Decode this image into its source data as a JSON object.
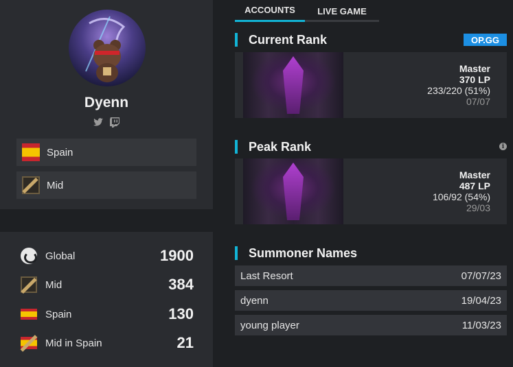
{
  "profile": {
    "name": "Dyenn",
    "socials": [
      {
        "icon": "twitter-icon"
      },
      {
        "icon": "twitch-icon"
      }
    ],
    "country": "Spain",
    "role": "Mid"
  },
  "rankings": [
    {
      "icon": "globe-icon",
      "label": "Global",
      "value": "1900"
    },
    {
      "icon": "mid-lane-icon",
      "label": "Mid",
      "value": "384"
    },
    {
      "icon": "spain-flag-icon",
      "label": "Spain",
      "value": "130"
    },
    {
      "icon": "mid-spain-icon",
      "label": "Mid in Spain",
      "value": "21"
    }
  ],
  "tabs": {
    "accounts": "ACCOUNTS",
    "live_game": "LIVE GAME"
  },
  "current_rank": {
    "title": "Current Rank",
    "badge": "OP.GG",
    "tier": "Master",
    "lp": "370 LP",
    "record": "233/220 (51%)",
    "date": "07/07"
  },
  "peak_rank": {
    "title": "Peak Rank",
    "tier": "Master",
    "lp": "487 LP",
    "record": "106/92 (54%)",
    "date": "29/03"
  },
  "summoner_names": {
    "title": "Summoner Names",
    "rows": [
      {
        "name": "Last Resort",
        "date": "07/07/23"
      },
      {
        "name": "dyenn",
        "date": "19/04/23"
      },
      {
        "name": "young player",
        "date": "11/03/23"
      }
    ]
  },
  "colors": {
    "accent": "#12b4d6",
    "opgg_badge": "#1c8fe3",
    "background": "#1e2023",
    "panel": "#2a2c30"
  }
}
